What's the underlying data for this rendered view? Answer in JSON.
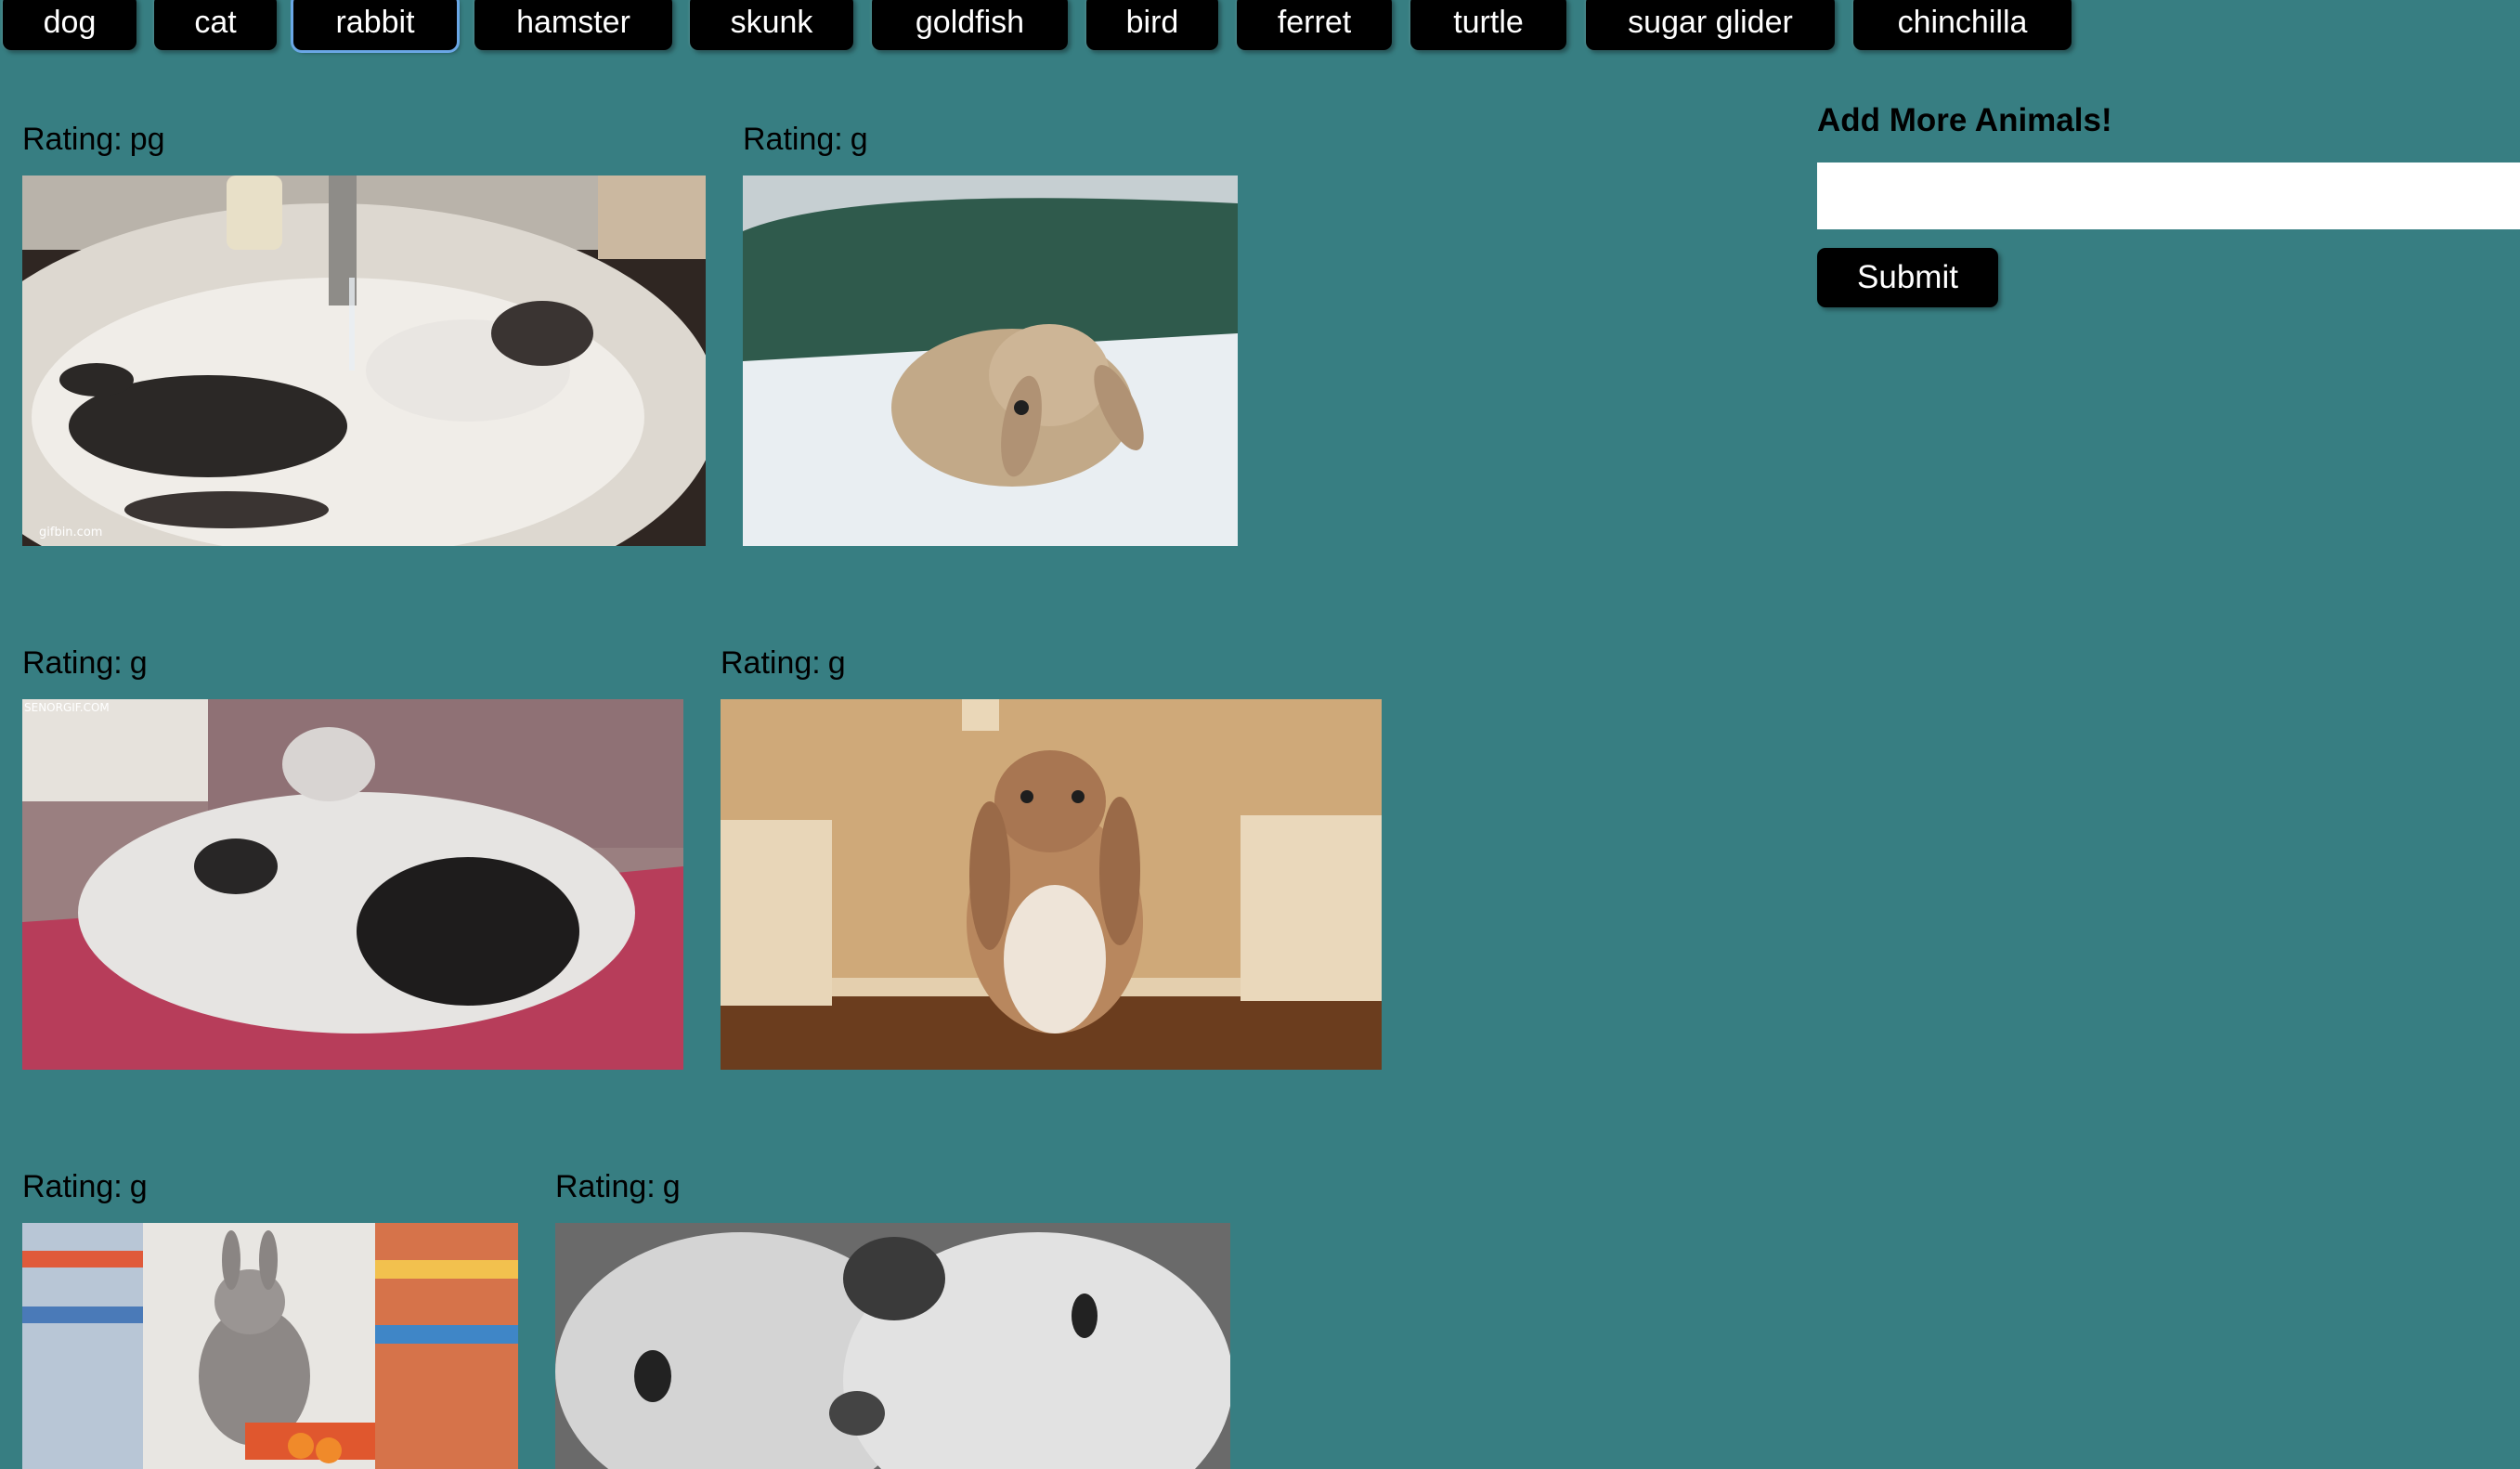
{
  "animal_buttons": [
    "dog",
    "cat",
    "rabbit",
    "hamster",
    "skunk",
    "goldfish",
    "bird",
    "ferret",
    "turtle",
    "sugar glider",
    "chinchilla"
  ],
  "active_animal": "rabbit",
  "rating_label": "Rating:",
  "gifs": [
    {
      "rating": "pg",
      "watermark": "gifbin.com"
    },
    {
      "rating": "g",
      "watermark": ""
    },
    {
      "rating": "g",
      "watermark": "SENORGIF.COM"
    },
    {
      "rating": "g",
      "watermark": ""
    },
    {
      "rating": "g",
      "watermark": ""
    },
    {
      "rating": "g",
      "watermark": ""
    }
  ],
  "add_form": {
    "title": "Add More Animals!",
    "input_value": "",
    "input_placeholder": "",
    "submit_label": "Submit"
  },
  "colors": {
    "background": "#377e82",
    "button": "#000000",
    "button_text": "#ffffff",
    "active_outline": "#6aa7e6"
  }
}
